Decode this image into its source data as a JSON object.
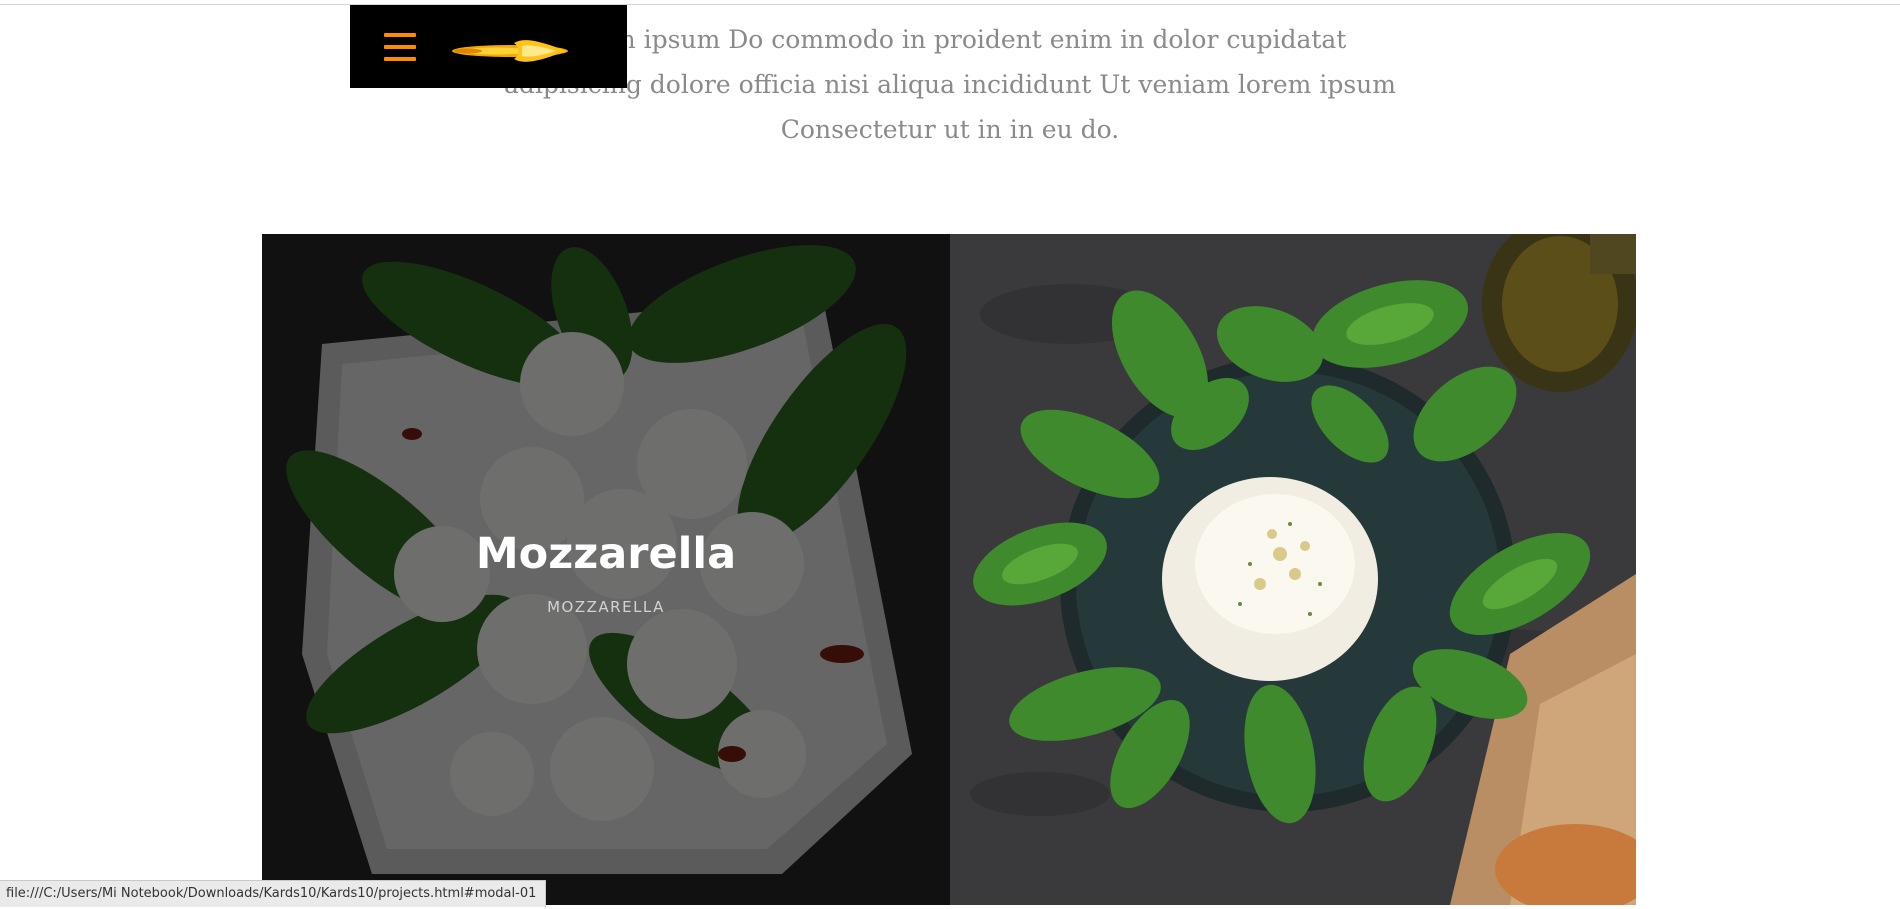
{
  "intro": {
    "line1": "Lorem ipsum Do commodo in proident enim in dolor cupidatat",
    "line2": "adipisicing dolore officia nisi aliqua incididunt Ut veniam lorem ipsum",
    "line3": "Consectetur ut in in eu do."
  },
  "navbar": {
    "menu_icon": "hamburger-menu-icon",
    "logo_icon": "flame-logo-icon",
    "accent_color": "#ff8a00",
    "background_color": "#000000"
  },
  "gallery": {
    "cards": [
      {
        "title": "Mozzarella",
        "subtitle": "MOZZARELLA",
        "hover_overlay": true
      },
      {
        "title": "",
        "subtitle": "",
        "hover_overlay": false
      }
    ]
  },
  "status_bar": {
    "url": "file:///C:/Users/Mi Notebook/Downloads/Kards10/Kards10/projects.html#modal-01"
  }
}
